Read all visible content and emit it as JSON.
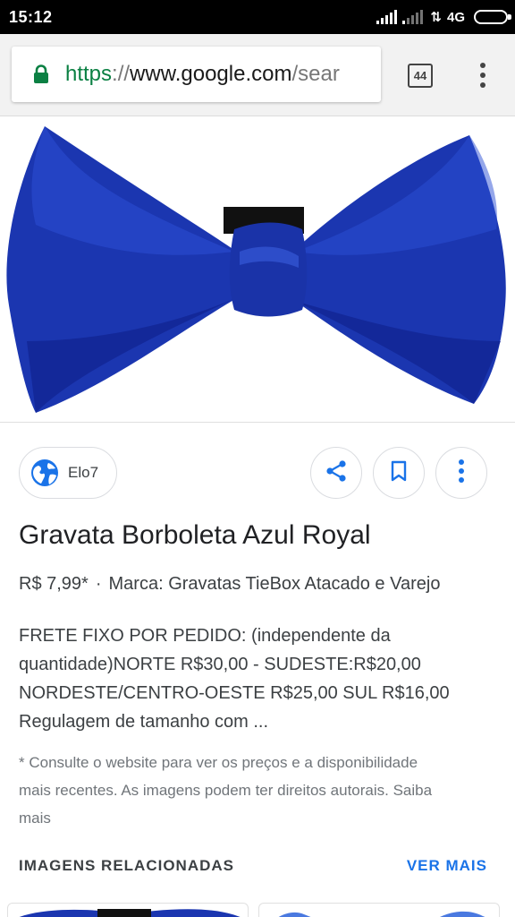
{
  "status_bar": {
    "time": "15:12",
    "network": "4G",
    "signal_icons": [
      "signal-icon",
      "signal-weak-icon",
      "data-arrows-icon",
      "battery-icon"
    ]
  },
  "browser": {
    "url_scheme": "https",
    "url_separator": "://",
    "url_host": "www.google.com",
    "url_path": "/sear",
    "tab_count": "44",
    "icons": [
      "lock-icon",
      "tabs-icon",
      "overflow-menu-icon"
    ],
    "accent_color": "#0b8043"
  },
  "image": {
    "subject_colors": [
      "#1b36b0",
      "#0f2290",
      "#2c4fd6"
    ]
  },
  "result": {
    "source": "Elo7",
    "source_icon": "globe-icon",
    "actions": [
      "share-icon",
      "bookmark-icon",
      "more-vert-icon"
    ],
    "title": "Gravata Borboleta Azul Royal",
    "price": "R$ 7,99*",
    "separator": "·",
    "brand": "Marca: Gravatas TieBox Atacado e Varejo",
    "description_lines": [
      "FRETE FIXO POR PEDIDO: (independente da",
      "quantidade)NORTE R$30,00 - SUDESTE:R$20,00",
      "NORDESTE/CENTRO-OESTE R$25,00 SUL R$16,00",
      "Regulagem de tamanho com ..."
    ],
    "disclaimer_lines": [
      "* Consulte o website para ver os preços e a disponibilidade",
      "mais recentes. As imagens podem ter direitos autorais. Saiba",
      "mais"
    ]
  },
  "related": {
    "title": "IMAGENS RELACIONADAS",
    "see_more": "VER MAIS",
    "link_color": "#1a73e8"
  }
}
